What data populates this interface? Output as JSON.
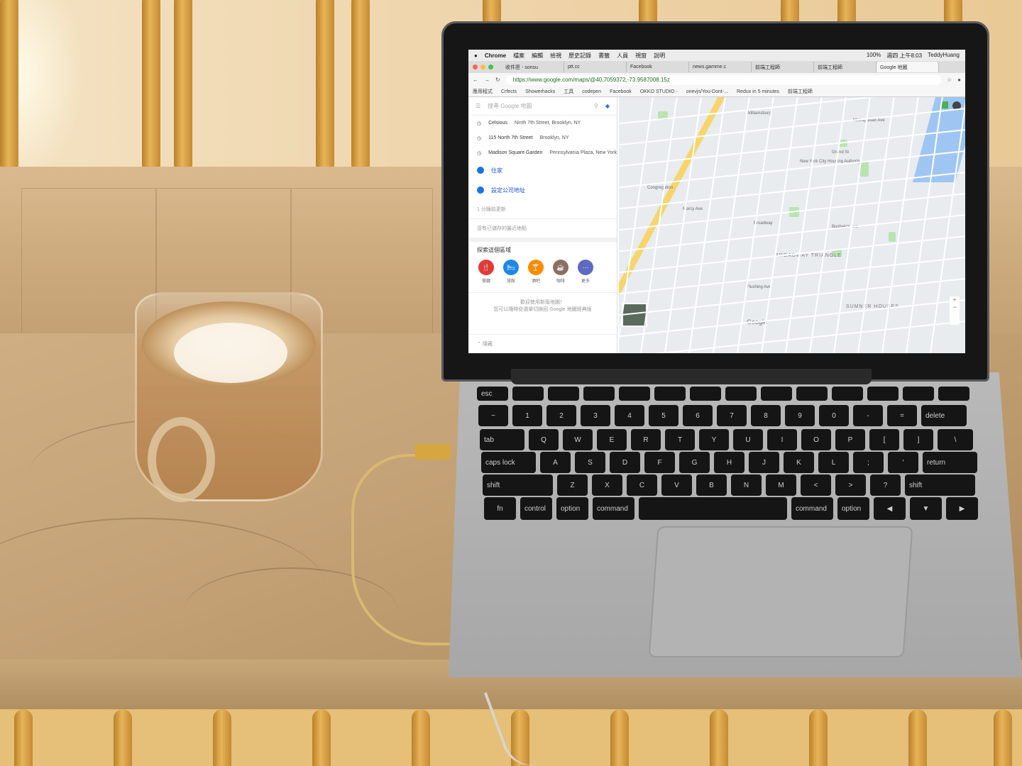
{
  "browser": {
    "menubar": {
      "app": "Chrome",
      "items": [
        "檔案",
        "編輯",
        "檢視",
        "歷史記錄",
        "書籤",
        "人員",
        "視窗",
        "說明"
      ],
      "status": [
        "100%",
        "週四 上午8:03",
        "TeddyHuang"
      ]
    },
    "tabs": [
      {
        "label": "收件匣 - sonsu",
        "active": false
      },
      {
        "label": "ptt.cc",
        "active": false
      },
      {
        "label": "Facebook",
        "active": false
      },
      {
        "label": "news.gamme.c",
        "active": false
      },
      {
        "label": "前端工程師",
        "active": false
      },
      {
        "label": "前端工程師",
        "active": false
      },
      {
        "label": "Google 地圖",
        "active": true
      }
    ],
    "url": "https://www.google.com/maps/@40.7059372,-73.9587008,15z",
    "bookmarks": [
      "應用程式",
      "Crfects",
      "Showerhacks",
      "工具",
      "codepen",
      "Facebook",
      "OKKO STUDIO -",
      "onevjs/You-Dont-...",
      "Redux in 5 minutes",
      "前端工程師"
    ]
  },
  "maps": {
    "search_placeholder": "搜尋 Google 地圖",
    "recent": [
      {
        "name": "Celsious",
        "address": "Ninth 7th Street, Brooklyn, NY"
      },
      {
        "name": "115 North 7th Street",
        "address": "Brooklyn, NY"
      },
      {
        "name": "Madison Square Garden",
        "address": "Pennsylvania Plaza, New York"
      }
    ],
    "places": [
      {
        "label": "住家",
        "icon": "home-icon"
      },
      {
        "label": "設定公司地址",
        "icon": "work-icon"
      }
    ],
    "timeline": "1 分鐘前更新",
    "saved_note": "沒有已儲存的最近地點",
    "explore_title": "探索這個區域",
    "categories": [
      {
        "label": "餐廳",
        "color": "#e53935",
        "glyph": "🍴"
      },
      {
        "label": "旅館",
        "color": "#1e88e5",
        "glyph": "🛏"
      },
      {
        "label": "酒吧",
        "color": "#fb8c00",
        "glyph": "🍸"
      },
      {
        "label": "咖啡",
        "color": "#8d6e63",
        "glyph": "☕"
      },
      {
        "label": "更多",
        "color": "#5c6bc0",
        "glyph": "⋯"
      }
    ],
    "footer_text": "歡迎使用新版地圖！",
    "footer_sub": "您可以隨時從選單切換回 Google 地圖經典版",
    "collapse_label": "隱藏",
    "map_labels": [
      "Williamsburg",
      "New York City Housing Authority",
      "BROADWAY TRIANGLE",
      "SUMNER HOUSES",
      "Bushwick Ave",
      "Metropolitan Ave",
      "Grand St",
      "Flushing Ave",
      "Congregation",
      "Marcy Ave",
      "Broadway"
    ],
    "google_logo": "Google"
  },
  "keyboard": {
    "rows": [
      [
        "esc",
        "",
        "",
        "",
        "",
        "",
        "",
        "",
        "",
        "",
        "",
        "",
        "",
        ""
      ],
      [
        "~",
        "1",
        "2",
        "3",
        "4",
        "5",
        "6",
        "7",
        "8",
        "9",
        "0",
        "-",
        "=",
        "delete"
      ],
      [
        "tab",
        "Q",
        "W",
        "E",
        "R",
        "T",
        "Y",
        "U",
        "I",
        "O",
        "P",
        "[",
        "]",
        "\\"
      ],
      [
        "caps lock",
        "A",
        "S",
        "D",
        "F",
        "G",
        "H",
        "J",
        "K",
        "L",
        ";",
        "'",
        "return"
      ],
      [
        "shift",
        "Z",
        "X",
        "C",
        "V",
        "B",
        "N",
        "M",
        "<",
        ">",
        "?",
        "shift"
      ],
      [
        "fn",
        "control",
        "option",
        "command",
        "",
        "command",
        "option",
        "◀",
        "▼",
        "▶"
      ]
    ]
  }
}
